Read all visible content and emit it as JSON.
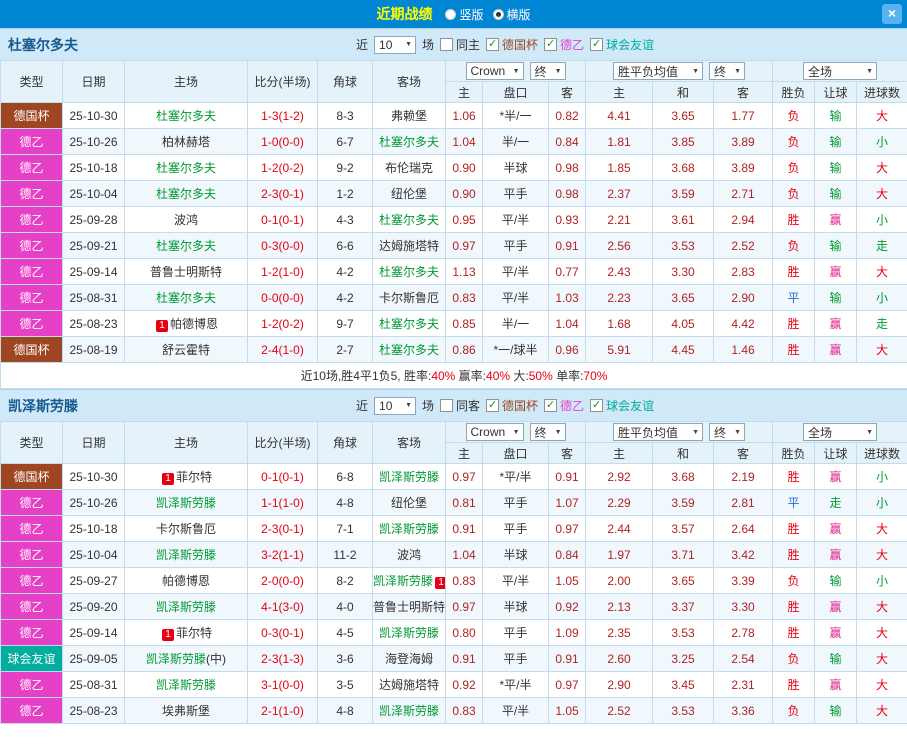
{
  "topbar": {
    "title": "近期战绩",
    "vertical_label": "竖版",
    "horizontal_label": "横版",
    "selected_layout": "横版",
    "close_glyph": "×"
  },
  "colors": {
    "topbar_bg": "#0086d2",
    "title": "#ffff00",
    "close_bg": "#56b3ee",
    "teambar_bg": "#cfe9f8",
    "team_name": "#175a8e",
    "header_bg": "#e6f2fa",
    "row_alt_bg": "#f1f8fd",
    "grid": "#c3dcec",
    "cup": "#9e4522",
    "b2": "#e640c6",
    "friendly": "#00ad9e",
    "focus_team": "#009933",
    "score": "#e60012",
    "odds": "#b22222",
    "red": "#e60012",
    "green": "#009933",
    "blue": "#1d6fce",
    "magenta": "#e0218a",
    "dark": "#333333"
  },
  "table_header": {
    "type": "类型",
    "date": "日期",
    "home": "主场",
    "score": "比分(半场)",
    "corner": "角球",
    "away": "客场",
    "book_select": "Crown",
    "book_final": "终",
    "odds_sub": [
      "主",
      "盘口",
      "客"
    ],
    "avg_select": "胜平负均值",
    "avg_final": "终",
    "avg_sub": [
      "主",
      "和",
      "客"
    ],
    "scope_select": "全场",
    "result_sub": [
      "胜负",
      "让球",
      "进球数"
    ]
  },
  "sections": [
    {
      "team": "杜塞尔多夫",
      "controls": {
        "near": "近",
        "count": "10",
        "unit": "场",
        "same_label": "同主",
        "same_checked": false,
        "leagues": [
          {
            "label": "德国杯",
            "key": "cup",
            "checked": true
          },
          {
            "label": "德乙",
            "key": "b2",
            "checked": true
          },
          {
            "label": "球会友谊",
            "key": "friendly",
            "checked": true
          }
        ]
      },
      "rows": [
        {
          "type": "德国杯",
          "tk": "cup",
          "date": "25-10-30",
          "home": {
            "n": "杜塞尔多夫",
            "f": true
          },
          "score": "1-3(1-2)",
          "corner": "8-3",
          "away": {
            "n": "弗赖堡"
          },
          "odds": [
            "1.06",
            "*半/一",
            "0.82"
          ],
          "avg": [
            "4.41",
            "3.65",
            "1.77"
          ],
          "res": [
            [
              "负",
              "red"
            ],
            [
              "输",
              "green"
            ],
            [
              "大",
              "red"
            ]
          ]
        },
        {
          "type": "德乙",
          "tk": "b2",
          "date": "25-10-26",
          "home": {
            "n": "柏林赫塔"
          },
          "score": "1-0(0-0)",
          "corner": "6-7",
          "away": {
            "n": "杜塞尔多夫",
            "f": true
          },
          "odds": [
            "1.04",
            "半/一",
            "0.84"
          ],
          "avg": [
            "1.81",
            "3.85",
            "3.89"
          ],
          "res": [
            [
              "负",
              "red"
            ],
            [
              "输",
              "green"
            ],
            [
              "小",
              "green"
            ]
          ]
        },
        {
          "type": "德乙",
          "tk": "b2",
          "date": "25-10-18",
          "home": {
            "n": "杜塞尔多夫",
            "f": true
          },
          "score": "1-2(0-2)",
          "corner": "9-2",
          "away": {
            "n": "布伦瑞克"
          },
          "odds": [
            "0.90",
            "半球",
            "0.98"
          ],
          "avg": [
            "1.85",
            "3.68",
            "3.89"
          ],
          "res": [
            [
              "负",
              "red"
            ],
            [
              "输",
              "green"
            ],
            [
              "大",
              "red"
            ]
          ]
        },
        {
          "type": "德乙",
          "tk": "b2",
          "date": "25-10-04",
          "home": {
            "n": "杜塞尔多夫",
            "f": true
          },
          "score": "2-3(0-1)",
          "corner": "1-2",
          "away": {
            "n": "纽伦堡"
          },
          "odds": [
            "0.90",
            "平手",
            "0.98"
          ],
          "avg": [
            "2.37",
            "3.59",
            "2.71"
          ],
          "res": [
            [
              "负",
              "red"
            ],
            [
              "输",
              "green"
            ],
            [
              "大",
              "red"
            ]
          ]
        },
        {
          "type": "德乙",
          "tk": "b2",
          "date": "25-09-28",
          "home": {
            "n": "波鸿"
          },
          "score": "0-1(0-1)",
          "corner": "4-3",
          "away": {
            "n": "杜塞尔多夫",
            "f": true
          },
          "odds": [
            "0.95",
            "平/半",
            "0.93"
          ],
          "avg": [
            "2.21",
            "3.61",
            "2.94"
          ],
          "res": [
            [
              "胜",
              "red"
            ],
            [
              "赢",
              "magenta"
            ],
            [
              "小",
              "green"
            ]
          ]
        },
        {
          "type": "德乙",
          "tk": "b2",
          "date": "25-09-21",
          "home": {
            "n": "杜塞尔多夫",
            "f": true
          },
          "score": "0-3(0-0)",
          "corner": "6-6",
          "away": {
            "n": "达姆施塔特"
          },
          "odds": [
            "0.97",
            "平手",
            "0.91"
          ],
          "avg": [
            "2.56",
            "3.53",
            "2.52"
          ],
          "res": [
            [
              "负",
              "red"
            ],
            [
              "输",
              "green"
            ],
            [
              "走",
              "green"
            ]
          ]
        },
        {
          "type": "德乙",
          "tk": "b2",
          "date": "25-09-14",
          "home": {
            "n": "普鲁士明斯特"
          },
          "score": "1-2(1-0)",
          "corner": "4-2",
          "away": {
            "n": "杜塞尔多夫",
            "f": true
          },
          "odds": [
            "1.13",
            "平/半",
            "0.77"
          ],
          "avg": [
            "2.43",
            "3.30",
            "2.83"
          ],
          "res": [
            [
              "胜",
              "red"
            ],
            [
              "赢",
              "magenta"
            ],
            [
              "大",
              "red"
            ]
          ]
        },
        {
          "type": "德乙",
          "tk": "b2",
          "date": "25-08-31",
          "home": {
            "n": "杜塞尔多夫",
            "f": true
          },
          "score": "0-0(0-0)",
          "corner": "4-2",
          "away": {
            "n": "卡尔斯鲁厄"
          },
          "odds": [
            "0.83",
            "平/半",
            "1.03"
          ],
          "avg": [
            "2.23",
            "3.65",
            "2.90"
          ],
          "res": [
            [
              "平",
              "blue"
            ],
            [
              "输",
              "green"
            ],
            [
              "小",
              "green"
            ]
          ]
        },
        {
          "type": "德乙",
          "tk": "b2",
          "date": "25-08-23",
          "home": {
            "n": "帕德博恩",
            "badge": "1"
          },
          "score": "1-2(0-2)",
          "corner": "9-7",
          "away": {
            "n": "杜塞尔多夫",
            "f": true
          },
          "odds": [
            "0.85",
            "半/一",
            "1.04"
          ],
          "avg": [
            "1.68",
            "4.05",
            "4.42"
          ],
          "res": [
            [
              "胜",
              "red"
            ],
            [
              "赢",
              "magenta"
            ],
            [
              "走",
              "green"
            ]
          ]
        },
        {
          "type": "德国杯",
          "tk": "cup",
          "date": "25-08-19",
          "home": {
            "n": "舒云霍特"
          },
          "score": "2-4(1-0)",
          "corner": "2-7",
          "away": {
            "n": "杜塞尔多夫",
            "f": true
          },
          "odds": [
            "0.86",
            "*一/球半",
            "0.96"
          ],
          "avg": [
            "5.91",
            "4.45",
            "1.46"
          ],
          "res": [
            [
              "胜",
              "red"
            ],
            [
              "赢",
              "magenta"
            ],
            [
              "大",
              "red"
            ]
          ]
        }
      ],
      "summary": [
        [
          "近10场,胜4平1负5, ",
          "dark"
        ],
        [
          "胜率:",
          "dark"
        ],
        [
          "40%",
          "red"
        ],
        [
          " 赢率:",
          "dark"
        ],
        [
          "40%",
          "red"
        ],
        [
          " 大:",
          "dark"
        ],
        [
          "50%",
          "red"
        ],
        [
          " 单率:",
          "dark"
        ],
        [
          "70%",
          "red"
        ]
      ]
    },
    {
      "team": "凯泽斯劳滕",
      "controls": {
        "near": "近",
        "count": "10",
        "unit": "场",
        "same_label": "同客",
        "same_checked": false,
        "leagues": [
          {
            "label": "德国杯",
            "key": "cup",
            "checked": true
          },
          {
            "label": "德乙",
            "key": "b2",
            "checked": true
          },
          {
            "label": "球会友谊",
            "key": "friendly",
            "checked": true
          }
        ]
      },
      "rows": [
        {
          "type": "德国杯",
          "tk": "cup",
          "date": "25-10-30",
          "home": {
            "n": "菲尔特",
            "badge": "1"
          },
          "score": "0-1(0-1)",
          "corner": "6-8",
          "away": {
            "n": "凯泽斯劳滕",
            "f": true
          },
          "odds": [
            "0.97",
            "*平/半",
            "0.91"
          ],
          "avg": [
            "2.92",
            "3.68",
            "2.19"
          ],
          "res": [
            [
              "胜",
              "red"
            ],
            [
              "赢",
              "magenta"
            ],
            [
              "小",
              "green"
            ]
          ]
        },
        {
          "type": "德乙",
          "tk": "b2",
          "date": "25-10-26",
          "home": {
            "n": "凯泽斯劳滕",
            "f": true
          },
          "score": "1-1(1-0)",
          "corner": "4-8",
          "away": {
            "n": "纽伦堡"
          },
          "odds": [
            "0.81",
            "平手",
            "1.07"
          ],
          "avg": [
            "2.29",
            "3.59",
            "2.81"
          ],
          "res": [
            [
              "平",
              "blue"
            ],
            [
              "走",
              "green"
            ],
            [
              "小",
              "green"
            ]
          ]
        },
        {
          "type": "德乙",
          "tk": "b2",
          "date": "25-10-18",
          "home": {
            "n": "卡尔斯鲁厄"
          },
          "score": "2-3(0-1)",
          "corner": "7-1",
          "away": {
            "n": "凯泽斯劳滕",
            "f": true
          },
          "odds": [
            "0.91",
            "平手",
            "0.97"
          ],
          "avg": [
            "2.44",
            "3.57",
            "2.64"
          ],
          "res": [
            [
              "胜",
              "red"
            ],
            [
              "赢",
              "magenta"
            ],
            [
              "大",
              "red"
            ]
          ]
        },
        {
          "type": "德乙",
          "tk": "b2",
          "date": "25-10-04",
          "home": {
            "n": "凯泽斯劳滕",
            "f": true
          },
          "score": "3-2(1-1)",
          "corner": "11-2",
          "away": {
            "n": "波鸿"
          },
          "odds": [
            "1.04",
            "半球",
            "0.84"
          ],
          "avg": [
            "1.97",
            "3.71",
            "3.42"
          ],
          "res": [
            [
              "胜",
              "red"
            ],
            [
              "赢",
              "magenta"
            ],
            [
              "大",
              "red"
            ]
          ]
        },
        {
          "type": "德乙",
          "tk": "b2",
          "date": "25-09-27",
          "home": {
            "n": "帕德博恩"
          },
          "score": "2-0(0-0)",
          "corner": "8-2",
          "away": {
            "n": "凯泽斯劳滕",
            "f": true,
            "badge": "1"
          },
          "odds": [
            "0.83",
            "平/半",
            "1.05"
          ],
          "avg": [
            "2.00",
            "3.65",
            "3.39"
          ],
          "res": [
            [
              "负",
              "red"
            ],
            [
              "输",
              "green"
            ],
            [
              "小",
              "green"
            ]
          ]
        },
        {
          "type": "德乙",
          "tk": "b2",
          "date": "25-09-20",
          "home": {
            "n": "凯泽斯劳滕",
            "f": true
          },
          "score": "4-1(3-0)",
          "corner": "4-0",
          "away": {
            "n": "普鲁士明斯特"
          },
          "odds": [
            "0.97",
            "半球",
            "0.92"
          ],
          "avg": [
            "2.13",
            "3.37",
            "3.30"
          ],
          "res": [
            [
              "胜",
              "red"
            ],
            [
              "赢",
              "magenta"
            ],
            [
              "大",
              "red"
            ]
          ]
        },
        {
          "type": "德乙",
          "tk": "b2",
          "date": "25-09-14",
          "home": {
            "n": "菲尔特",
            "badge": "1"
          },
          "score": "0-3(0-1)",
          "corner": "4-5",
          "away": {
            "n": "凯泽斯劳滕",
            "f": true
          },
          "odds": [
            "0.80",
            "平手",
            "1.09"
          ],
          "avg": [
            "2.35",
            "3.53",
            "2.78"
          ],
          "res": [
            [
              "胜",
              "red"
            ],
            [
              "赢",
              "magenta"
            ],
            [
              "大",
              "red"
            ]
          ]
        },
        {
          "type": "球会友谊",
          "tk": "friendly",
          "date": "25-09-05",
          "home": {
            "n": "凯泽斯劳滕",
            "f": true,
            "suffix": "(中)"
          },
          "score": "2-3(1-3)",
          "corner": "3-6",
          "away": {
            "n": "海登海姆"
          },
          "odds": [
            "0.91",
            "平手",
            "0.91"
          ],
          "avg": [
            "2.60",
            "3.25",
            "2.54"
          ],
          "res": [
            [
              "负",
              "red"
            ],
            [
              "输",
              "green"
            ],
            [
              "大",
              "red"
            ]
          ]
        },
        {
          "type": "德乙",
          "tk": "b2",
          "date": "25-08-31",
          "home": {
            "n": "凯泽斯劳滕",
            "f": true
          },
          "score": "3-1(0-0)",
          "corner": "3-5",
          "away": {
            "n": "达姆施塔特"
          },
          "odds": [
            "0.92",
            "*平/半",
            "0.97"
          ],
          "avg": [
            "2.90",
            "3.45",
            "2.31"
          ],
          "res": [
            [
              "胜",
              "red"
            ],
            [
              "赢",
              "magenta"
            ],
            [
              "大",
              "red"
            ]
          ]
        },
        {
          "type": "德乙",
          "tk": "b2",
          "date": "25-08-23",
          "home": {
            "n": "埃弗斯堡"
          },
          "score": "2-1(1-0)",
          "corner": "4-8",
          "away": {
            "n": "凯泽斯劳滕",
            "f": true
          },
          "odds": [
            "0.83",
            "平/半",
            "1.05"
          ],
          "avg": [
            "2.52",
            "3.53",
            "3.36"
          ],
          "res": [
            [
              "负",
              "red"
            ],
            [
              "输",
              "green"
            ],
            [
              "大",
              "red"
            ]
          ]
        }
      ]
    }
  ]
}
